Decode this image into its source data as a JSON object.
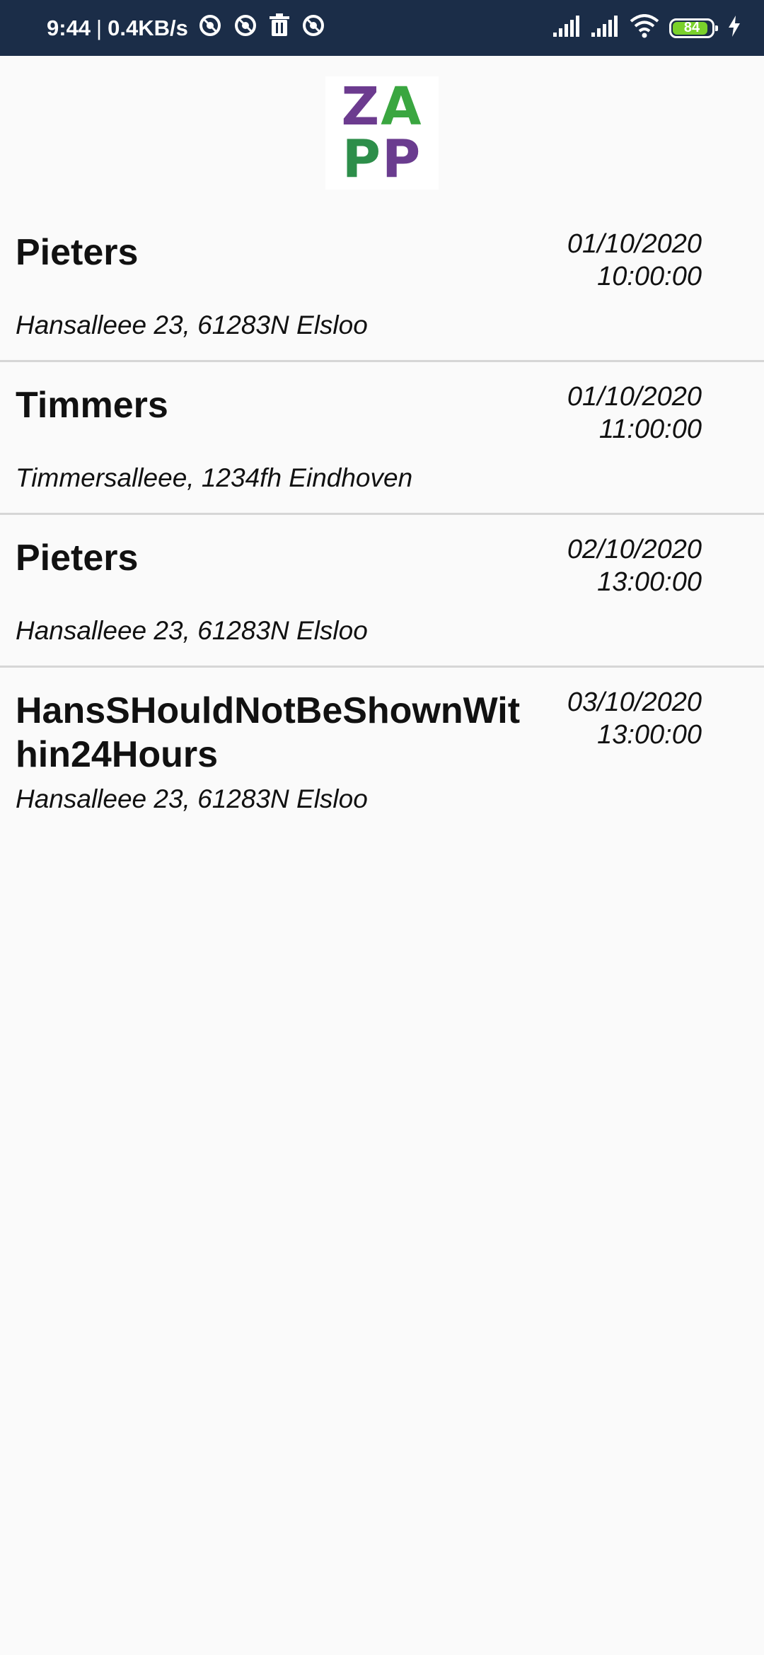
{
  "status_bar": {
    "time": "9:44",
    "separator": "|",
    "speed": "0.4KB/s",
    "battery_level": "84",
    "colors": {
      "background": "#1b2d48",
      "battery_fill": "#7ad12b"
    }
  },
  "logo": {
    "row1": [
      "Z",
      "A"
    ],
    "row2": [
      "P",
      "P"
    ]
  },
  "appointments": [
    {
      "name": "Pieters",
      "date": "01/10/2020",
      "time": "10:00:00",
      "address": "Hansalleee 23, 61283N Elsloo"
    },
    {
      "name": "Timmers",
      "date": "01/10/2020",
      "time": "11:00:00",
      "address": "Timmersalleee, 1234fh Eindhoven"
    },
    {
      "name": "Pieters",
      "date": "02/10/2020",
      "time": "13:00:00",
      "address": "Hansalleee 23, 61283N Elsloo"
    },
    {
      "name": "HansSHouldNotBeShownWithin24Hours",
      "date": "03/10/2020",
      "time": "13:00:00",
      "address": "Hansalleee 23, 61283N Elsloo"
    }
  ]
}
